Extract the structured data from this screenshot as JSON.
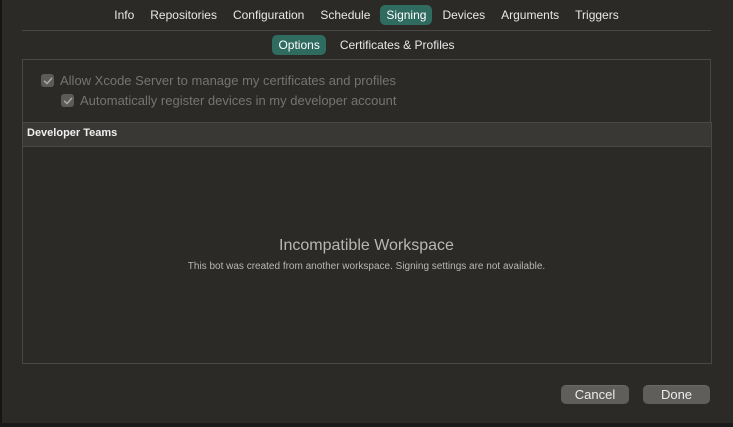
{
  "tabs": [
    {
      "label": "Info",
      "active": false
    },
    {
      "label": "Repositories",
      "active": false
    },
    {
      "label": "Configuration",
      "active": false
    },
    {
      "label": "Schedule",
      "active": false
    },
    {
      "label": "Signing",
      "active": true
    },
    {
      "label": "Devices",
      "active": false
    },
    {
      "label": "Arguments",
      "active": false
    },
    {
      "label": "Triggers",
      "active": false
    }
  ],
  "subtabs": [
    {
      "label": "Options",
      "active": true
    },
    {
      "label": "Certificates & Profiles",
      "active": false
    }
  ],
  "options": {
    "manage_certificates": {
      "label": "Allow Xcode Server to manage my certificates and profiles",
      "checked": true,
      "enabled": false
    },
    "register_devices": {
      "label": "Automatically register devices in my developer account",
      "checked": true,
      "enabled": false
    }
  },
  "developer_teams": {
    "header": "Developer Teams",
    "empty_title": "Incompatible Workspace",
    "empty_message": "This bot was created from another workspace. Signing settings are not available."
  },
  "buttons": {
    "cancel": "Cancel",
    "done": "Done"
  },
  "colors": {
    "accent": "#2f6b5f",
    "background": "#2c2a27",
    "header_bg": "#3a3835"
  }
}
